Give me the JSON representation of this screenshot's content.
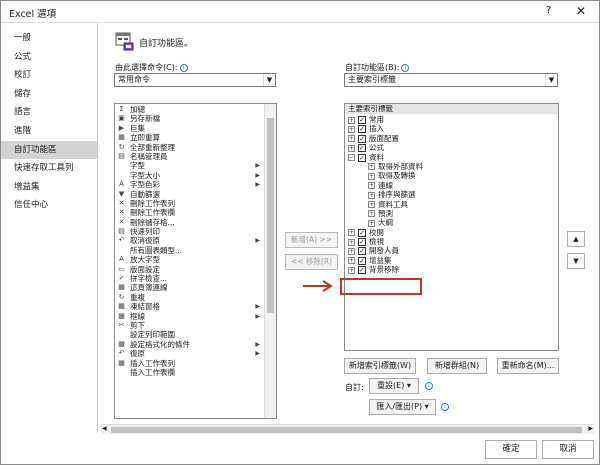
{
  "window": {
    "title": "Excel 選項",
    "help": "?",
    "close": "✕"
  },
  "sidebar": {
    "items": [
      {
        "label": "一般",
        "active": false
      },
      {
        "label": "公式",
        "active": false
      },
      {
        "label": "校訂",
        "active": false
      },
      {
        "label": "儲存",
        "active": false
      },
      {
        "label": "語言",
        "active": false
      },
      {
        "label": "進階",
        "active": false
      },
      {
        "label": "自訂功能區",
        "active": true
      },
      {
        "label": "快速存取工具列",
        "active": false
      },
      {
        "label": "增益集",
        "active": false
      },
      {
        "label": "信任中心",
        "active": false
      }
    ]
  },
  "header": {
    "title": "自訂功能區。"
  },
  "left": {
    "label": "由此選擇命令(C):",
    "combo_value": "常用命令",
    "commands": [
      {
        "icon": "Σ",
        "label": "加總",
        "submenu": false
      },
      {
        "icon": "▣",
        "label": "另存新檔",
        "submenu": false
      },
      {
        "icon": "▶",
        "label": "巨集",
        "submenu": false
      },
      {
        "icon": "▦",
        "label": "立即重算",
        "submenu": false
      },
      {
        "icon": "↻",
        "label": "全部重新整理",
        "submenu": false
      },
      {
        "icon": "▤",
        "label": "名稱管理員",
        "submenu": false
      },
      {
        "icon": "",
        "label": "字型",
        "submenu": true
      },
      {
        "icon": "",
        "label": "字型大小",
        "submenu": true
      },
      {
        "icon": "A",
        "label": "字型色彩",
        "submenu": true
      },
      {
        "icon": "▼",
        "label": "自動篩選",
        "submenu": false
      },
      {
        "icon": "✕",
        "label": "刪除工作表列",
        "submenu": false
      },
      {
        "icon": "✕",
        "label": "刪除工作表欄",
        "submenu": false
      },
      {
        "icon": "✕",
        "label": "刪除儲存格...",
        "submenu": false
      },
      {
        "icon": "▤",
        "label": "快速列印",
        "submenu": false
      },
      {
        "icon": "↶",
        "label": "取消復原",
        "submenu": true
      },
      {
        "icon": "",
        "label": "所有圖表類型...",
        "submenu": false
      },
      {
        "icon": "A",
        "label": "放大字型",
        "submenu": false
      },
      {
        "icon": "▭",
        "label": "版面設定",
        "submenu": false
      },
      {
        "icon": "✓",
        "label": "拼字檢查...",
        "submenu": false
      },
      {
        "icon": "▦",
        "label": "這頁簿連線",
        "submenu": false
      },
      {
        "icon": "↻",
        "label": "重複",
        "submenu": false
      },
      {
        "icon": "▦",
        "label": "凍結窗格",
        "submenu": true
      },
      {
        "icon": "▦",
        "label": "框線",
        "submenu": true
      },
      {
        "icon": "✂",
        "label": "剪下",
        "submenu": false
      },
      {
        "icon": "",
        "label": "設定列印範圍",
        "submenu": false
      },
      {
        "icon": "▦",
        "label": "設定格式化的條件",
        "submenu": true
      },
      {
        "icon": "↶",
        "label": "復原",
        "submenu": true
      },
      {
        "icon": "▦",
        "label": "插入工作表列",
        "submenu": false
      },
      {
        "icon": "",
        "label": "插入工作表欄",
        "submenu": false
      }
    ]
  },
  "middle": {
    "add_label": "新增(A) >>",
    "remove_label": "<< 移除(R)"
  },
  "right": {
    "label": "自訂功能區(B):",
    "combo_value": "主要索引標籤",
    "tree_header": "主要索引標籤",
    "tree": [
      {
        "label": "常用",
        "level": 0,
        "expander": "+",
        "checked": true
      },
      {
        "label": "插入",
        "level": 0,
        "expander": "+",
        "checked": true
      },
      {
        "label": "版面配置",
        "level": 0,
        "expander": "+",
        "checked": true
      },
      {
        "label": "公式",
        "level": 0,
        "expander": "+",
        "checked": true
      },
      {
        "label": "資料",
        "level": 0,
        "expander": "−",
        "checked": true
      },
      {
        "label": "取得外部資料",
        "level": 1,
        "expander": "+",
        "checked": false
      },
      {
        "label": "取得及轉換",
        "level": 1,
        "expander": "+",
        "checked": false
      },
      {
        "label": "連線",
        "level": 1,
        "expander": "+",
        "checked": false
      },
      {
        "label": "排序與篩選",
        "level": 1,
        "expander": "+",
        "checked": false
      },
      {
        "label": "資料工具",
        "level": 1,
        "expander": "+",
        "checked": false
      },
      {
        "label": "預測",
        "level": 1,
        "expander": "+",
        "checked": false
      },
      {
        "label": "大綱",
        "level": 1,
        "expander": "+",
        "checked": false
      },
      {
        "label": "校閱",
        "level": 0,
        "expander": "+",
        "checked": true
      },
      {
        "label": "檢視",
        "level": 0,
        "expander": "+",
        "checked": true
      },
      {
        "label": "開發人員",
        "level": 0,
        "expander": "+",
        "checked": true
      },
      {
        "label": "增益集",
        "level": 0,
        "expander": "+",
        "checked": true
      },
      {
        "label": "背景移除",
        "level": 0,
        "expander": "+",
        "checked": true
      }
    ],
    "new_tab_label": "新增索引標籤(W)",
    "new_group_label": "新增群組(N)",
    "rename_label": "重新命名(M)...",
    "custom_label": "自訂:",
    "reset_label": "重設(E) ▾",
    "import_export_label": "匯入/匯出(P) ▾"
  },
  "footer": {
    "ok_label": "確定",
    "cancel_label": "取消"
  },
  "colors": {
    "highlight_box": "#b43a2e",
    "info_icon": "#3b7bd4"
  }
}
